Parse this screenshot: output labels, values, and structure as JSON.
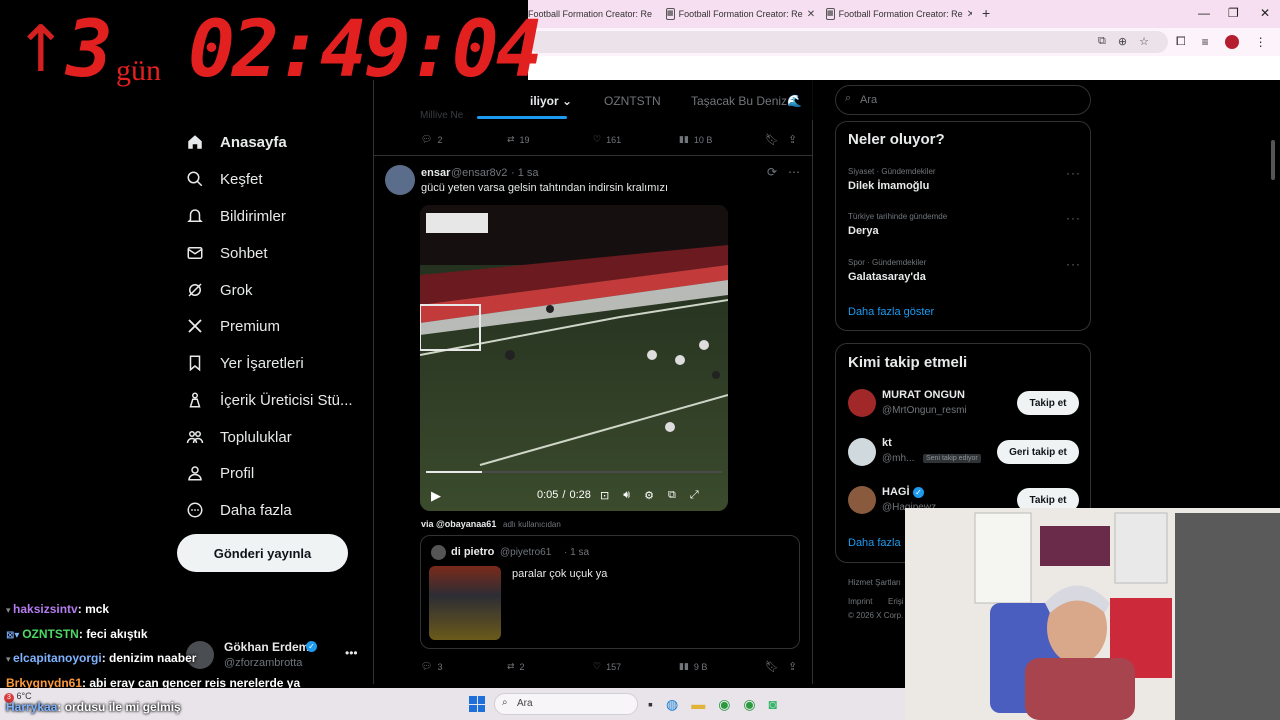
{
  "timer": {
    "arrow": "↑",
    "days": "3",
    "days_label": "gün",
    "clock": "02:49:04"
  },
  "browser": {
    "tabs": [
      "Football Formation Creator: Re",
      "Football Formation Creator: Re",
      "Football Formation Creator: Re"
    ],
    "new_tab": "+"
  },
  "nav": {
    "items": [
      "Anasayfa",
      "Keşfet",
      "Bildirimler",
      "Sohbet",
      "Grok",
      "Premium",
      "Yer İşaretleri",
      "İçerik Üreticisi Stü...",
      "Topluluklar",
      "Profil",
      "Daha fazla"
    ],
    "post_button": "Gönderi yayınla"
  },
  "account": {
    "name": "Gökhan Erdem",
    "handle": "@zforzambrotta"
  },
  "top_tabs": {
    "faded": "Millive Ne",
    "active": "iliyor",
    "tab2": "OZNTSTN",
    "tab3": "Taşacak Bu Deniz🌊"
  },
  "prev_post_actions": {
    "replies": "2",
    "reposts": "19",
    "likes": "161",
    "views": "10 B"
  },
  "post": {
    "name": "ensar",
    "handle": "@ensar8v2",
    "time": "· 1 sa",
    "text": "gücü yeten varsa gelsin tahtından indirsin kralımızı",
    "video_time": "0:05",
    "video_sep": "/",
    "video_duration": "0:28",
    "via_user": "via @obayanaa61",
    "via_suffix": "adlı kullanıcıdan",
    "quote": {
      "name": "di pietro",
      "handle": "@piyetro61",
      "time": "· 1 sa",
      "text": "paralar çok uçuk ya"
    },
    "actions": {
      "replies": "3",
      "reposts": "2",
      "likes": "157",
      "views": "9 B"
    }
  },
  "right": {
    "search_placeholder": "Ara",
    "trends_title": "Neler oluyor?",
    "trends": [
      {
        "category": "Siyaset · Gündemdekiler",
        "name": "Dilek İmamoğlu"
      },
      {
        "category": "Türkiye tarihinde gündemde",
        "name": "Derya"
      },
      {
        "category": "Spor · Gündemdekiler",
        "name": "Galatasaray'da"
      }
    ],
    "show_more": "Daha fazla göster",
    "follow_title": "Kimi takip etmeli",
    "follow": [
      {
        "name": "MURAT ONGUN",
        "handle": "@MrtOngun_resmi",
        "button": "Takip et"
      },
      {
        "name": "kt",
        "handle": "@mh...",
        "badge": "Seni takip ediyor",
        "button": "Geri takip et"
      },
      {
        "name": "HAGİ",
        "handle": "@Hagipewz",
        "button": "Takip et"
      }
    ],
    "follow_more": "Daha fazla",
    "footer": [
      "Hizmet Şartları",
      "Imprint",
      "Erişi",
      "© 2026 X Corp."
    ]
  },
  "chat": [
    {
      "user": "haksizsintv",
      "msg": ": mck",
      "color": "#b57cf0"
    },
    {
      "user": "OZNTSTN",
      "msg": ": feci akıştık",
      "color": "#4cd964"
    },
    {
      "user": "elcapitanoyorgi",
      "msg": ": denizim naaber",
      "color": "#7fb3ff"
    },
    {
      "user": "Brkygnydn61",
      "msg": ": abi eray can gencer reis nerelerde ya",
      "color": "#ff9a3c"
    },
    {
      "user": "Harrykaa",
      "msg": ": ordusu ile mi gelmiş",
      "color": "#7fb3ff"
    }
  ],
  "taskbar": {
    "weather": "6°C",
    "search": "Ara",
    "badge": "3"
  },
  "colors": {
    "accent": "#1d9bf0",
    "timer": "#e32020",
    "bg": "#000000"
  }
}
